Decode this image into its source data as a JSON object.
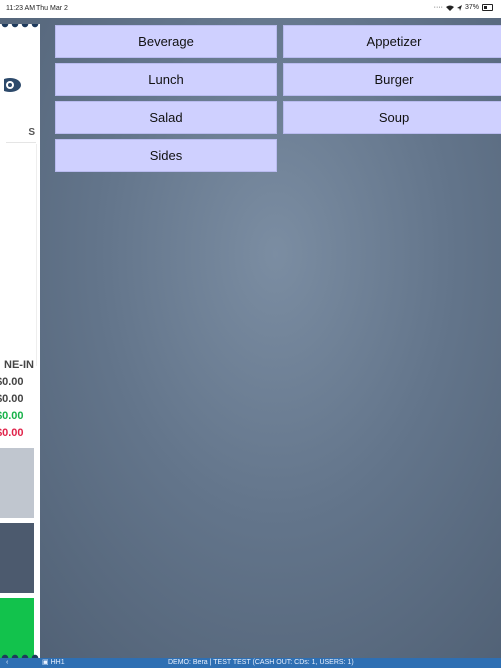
{
  "status_bar": {
    "time": "11:23 AM",
    "date": "Thu Mar 2",
    "battery": "37%"
  },
  "ticket": {
    "column_header": "S",
    "order_type": "NE-IN",
    "totals": [
      {
        "value": "$0.00",
        "color": "#444444"
      },
      {
        "value": "$0.00",
        "color": "#444444"
      },
      {
        "value": "$0.00",
        "color": "#18b24a"
      },
      {
        "value": "$0.00",
        "color": "#e0234a"
      }
    ]
  },
  "menu": {
    "categories": [
      {
        "label": "Beverage"
      },
      {
        "label": "Appetizer"
      },
      {
        "label": "Lunch"
      },
      {
        "label": "Burger"
      },
      {
        "label": "Salad"
      },
      {
        "label": "Soup"
      },
      {
        "label": "Sides"
      }
    ]
  },
  "footer": {
    "device": "HH1",
    "info": "DEMO: Bera | TEST TEST (CASH OUT: CDs: 1, USERS: 1)"
  },
  "colors": {
    "menu_button": "#cfd0ff",
    "footer_bar": "#2e6fb3",
    "background": "#63758b",
    "block_green": "#12c24c"
  }
}
